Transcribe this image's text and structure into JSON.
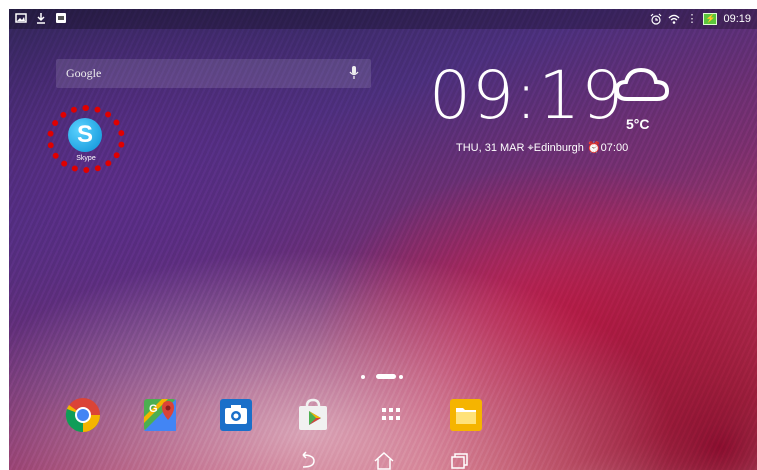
{
  "status_bar": {
    "left_icons": [
      "gallery-icon",
      "download-icon",
      "notification-icon"
    ],
    "right_icons": [
      "alarm-icon",
      "wifi-icon",
      "dots-icon",
      "battery-charging-icon"
    ],
    "time": "09:19"
  },
  "search_widget": {
    "label": "Google",
    "icon": "mic-icon"
  },
  "desktop_apps": [
    {
      "label": "Skype",
      "icon": "skype-icon"
    }
  ],
  "clock_widget": {
    "time": "09:19",
    "temperature": "5°C",
    "weather_icon": "cloud-icon",
    "date": "THU, 31 MAR",
    "location": "Edinburgh",
    "alarm": "07:00"
  },
  "dock": [
    {
      "icon": "chrome-icon"
    },
    {
      "icon": "maps-icon"
    },
    {
      "icon": "camera-icon"
    },
    {
      "icon": "play-store-icon"
    },
    {
      "icon": "app-drawer-icon"
    },
    {
      "icon": "file-manager-icon"
    }
  ],
  "nav_bar": [
    "back-icon",
    "home-icon",
    "recent-apps-icon"
  ],
  "colors": {
    "highlight_circle": "#e00000",
    "skype_blue": "#0a8fd6"
  }
}
